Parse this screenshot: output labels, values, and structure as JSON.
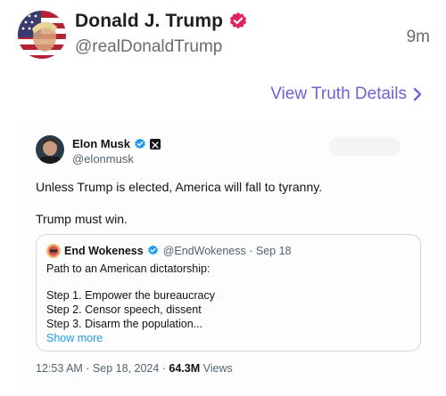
{
  "post": {
    "author_name": "Donald J. Trump",
    "author_handle": "@realDonaldTrump",
    "time_ago": "9m",
    "details_link": "View Truth Details"
  },
  "embed": {
    "author_name": "Elon Musk",
    "author_handle": "@elonmusk",
    "text_line_1": "Unless Trump is elected, America will fall to tyranny.",
    "text_line_2": "Trump must win.",
    "quote": {
      "author_name": "End Wokeness",
      "author_meta": "@EndWokeness · Sep 18",
      "line_1": "Path to an American dictatorship:",
      "line_2": "Step 1. Empower the bureaucracy",
      "line_3": "Step 2. Censor speech, dissent",
      "line_4": "Step 3. Disarm the population...",
      "show_more": "Show more"
    },
    "timestamp": "12:53 AM · Sep 18, 2024 · ",
    "views_count": "64.3M",
    "views_label": " Views"
  },
  "colors": {
    "truth_purple": "#6d63d6",
    "verified_red": "#e0245e",
    "x_blue": "#1d9bf0"
  },
  "icons": {
    "verified": "verified-badge-icon",
    "chevron": "chevron-right-icon",
    "x": "x-logo-icon"
  }
}
